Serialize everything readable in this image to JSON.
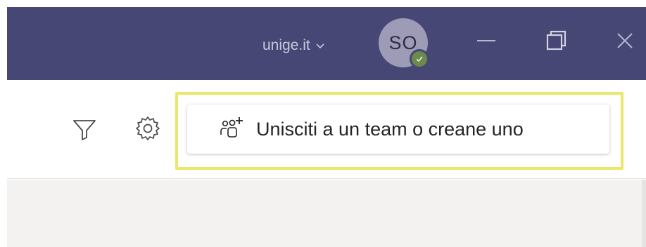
{
  "titlebar": {
    "org_name": "unige.it",
    "avatar_initials": "SO",
    "presence_status": "available",
    "background": "#464775"
  },
  "window_controls": {
    "minimize_icon": "minimize-icon",
    "restore_icon": "restore-icon",
    "close_icon": "close-icon"
  },
  "toolbar": {
    "filter_icon": "filter-icon",
    "settings_icon": "gear-icon",
    "join_button": {
      "label": "Unisciti a un team o creane uno",
      "icon": "people-add-icon"
    },
    "highlight_color": "#e9e86a"
  }
}
